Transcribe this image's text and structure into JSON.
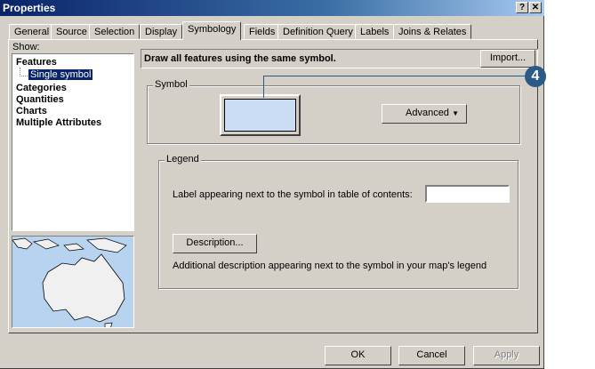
{
  "window": {
    "title": "Properties",
    "help_label": "?",
    "close_label": "✕"
  },
  "tabs": [
    "General",
    "Source",
    "Selection",
    "Display",
    "Symbology",
    "Fields",
    "Definition Query",
    "Labels",
    "Joins & Relates"
  ],
  "active_tab": "Symbology",
  "show": {
    "label": "Show:",
    "items": [
      "Features",
      "Categories",
      "Quantities",
      "Charts",
      "Multiple Attributes"
    ],
    "selected_sub": "Single symbol"
  },
  "headline": "Draw all features using the same symbol.",
  "import_label": "Import...",
  "symbol": {
    "group_label": "Symbol",
    "advanced_label": "Advanced",
    "fill_color": "#cbdcf5"
  },
  "legend": {
    "group_label": "Legend",
    "label_text": "Label appearing next to the symbol in table of contents:",
    "label_value": "",
    "description_button": "Description...",
    "description_text": "Additional description appearing next to the symbol in your map's legend"
  },
  "footer": {
    "ok": "OK",
    "cancel": "Cancel",
    "apply": "Apply"
  },
  "callout": {
    "number": "4",
    "color": "#2b5a86"
  },
  "colors": {
    "titlebar": "#0a246a",
    "selection": "#0a246a",
    "face": "#d4d0c8",
    "map_water": "#b7d3ef"
  }
}
